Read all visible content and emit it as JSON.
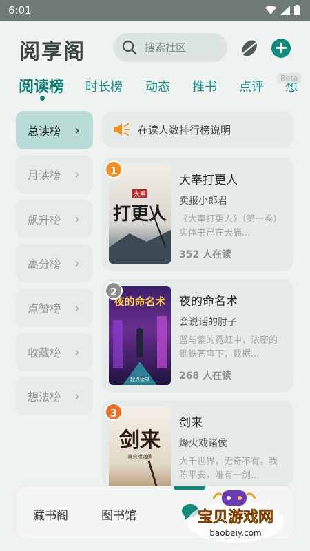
{
  "status": {
    "time": "6:01"
  },
  "header": {
    "title": "阅享阁",
    "search_placeholder": "搜索社区"
  },
  "tabs": [
    "阅读榜",
    "时长榜",
    "动态",
    "推书",
    "点评",
    "想"
  ],
  "beta_badge": "Beta",
  "sidebar": [
    {
      "label": "总读榜",
      "active": true
    },
    {
      "label": "月读榜"
    },
    {
      "label": "飙升榜"
    },
    {
      "label": "高分榜"
    },
    {
      "label": "点赞榜"
    },
    {
      "label": "收藏榜"
    },
    {
      "label": "想法榜"
    }
  ],
  "chevron": "›",
  "notice": {
    "text": "在读人数排行榜说明"
  },
  "books": [
    {
      "rank": "1",
      "rank_color": "#f5901e",
      "title": "大奉打更人",
      "author": "卖报小郎君",
      "desc": "《大奉打更人》（第一卷）实体书已在天猫...",
      "readers": "352 人在读",
      "cover_text": "打更人",
      "cover_small": "大奉"
    },
    {
      "rank": "2",
      "rank_color": "#8d8d8d",
      "title": "夜的命名术",
      "author": "会说话的肘子",
      "desc": "蓝与紫的霓虹中，浓密的钢铁苍穹下，数据...",
      "readers": "268 人在读",
      "cover_text": "夜的命名术",
      "cover_small": "起点读书"
    },
    {
      "rank": "3",
      "rank_color": "#f06a22",
      "title": "剑来",
      "author": "烽火戏诸侯",
      "desc": "大千世界，无奇不有。我陈平安，唯有一剑...",
      "readers": "",
      "cover_text": "剑来",
      "cover_small": "烽火戏诸侯"
    }
  ],
  "bottom_nav": [
    "藏书阁",
    "图书馆"
  ],
  "watermark": {
    "text": "宝贝游戏网",
    "url": "baobeiy.com"
  },
  "colors": {
    "accent": "#0f8a7d",
    "tab": "#1a8f83",
    "active_side": "#b9dcd6"
  }
}
